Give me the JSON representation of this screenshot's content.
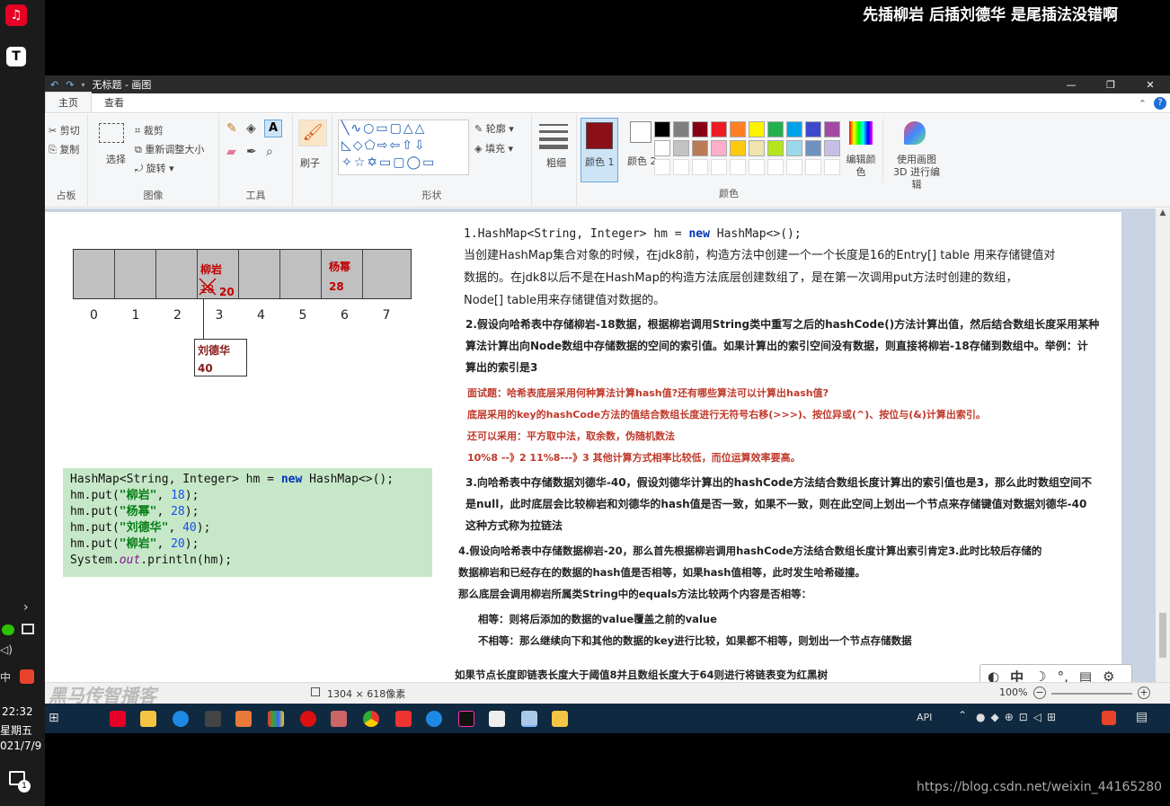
{
  "overlay_caption": "先插柳岩 后插刘德华 是尾插法没错啊",
  "left_taskbar": {
    "time": "22:32",
    "weekday": "星期五",
    "date": "021/7/9",
    "notify_badge": "1",
    "app_letter": "T"
  },
  "window": {
    "title": "无标题 - 画图",
    "tabs": [
      "主页",
      "查看"
    ]
  },
  "ribbon": {
    "clipboard": {
      "cut": "剪切",
      "copy": "复制",
      "label": "占板"
    },
    "image": {
      "select": "选择",
      "crop": "裁剪",
      "resize": "重新调整大小",
      "rotate": "旋转",
      "label": "图像"
    },
    "tools": {
      "label": "工具"
    },
    "brush": {
      "label": "刷子"
    },
    "shapes": {
      "outline": "轮廓",
      "fill": "填充",
      "label": "形状"
    },
    "size": {
      "label": "粗细"
    },
    "color1": {
      "label": "颜色 1",
      "value": "#8b0f18"
    },
    "color2": {
      "label": "颜色 2",
      "value": "#ffffff"
    },
    "edit_colors": "编辑颜色",
    "paint3d": "使用画图 3D 进行编辑",
    "colors_label": "颜色",
    "palette_row1": [
      "#000000",
      "#7f7f7f",
      "#880015",
      "#ed1c24",
      "#ff7f27",
      "#fff200",
      "#22b14c",
      "#00a2e8",
      "#3f48cc",
      "#a349a4"
    ],
    "palette_row2": [
      "#ffffff",
      "#c3c3c3",
      "#b97a57",
      "#ffaec9",
      "#ffc90e",
      "#efe4b0",
      "#b5e61d",
      "#99d9ea",
      "#7092be",
      "#c8bfe7"
    ]
  },
  "array_diagram": {
    "indices": [
      "0",
      "1",
      "2",
      "3",
      "4",
      "5",
      "6",
      "7"
    ],
    "cell3_name": "柳岩",
    "cell3_old": "18",
    "cell3_new": "20",
    "cell6_name": "杨幂",
    "cell6_value": "28",
    "node_name": "刘德华",
    "node_value": "40"
  },
  "code": {
    "line1_a": "HashMap<String, Integer> hm = ",
    "line1_kw": "new",
    "line1_b": " HashMap<>();",
    "puts": [
      {
        "key": "\"柳岩\"",
        "val": "18"
      },
      {
        "key": "\"杨幂\"",
        "val": "28"
      },
      {
        "key": "\"刘德华\"",
        "val": "40"
      },
      {
        "key": "\"柳岩\"",
        "val": "20"
      }
    ],
    "put_prefix": "hm.put(",
    "sep": ", ",
    "suffix": ");",
    "print_a": "System.",
    "print_out": "out",
    "print_b": ".println(hm);"
  },
  "notes": {
    "p1_code_a": "1.HashMap<String, Integer> hm = ",
    "p1_code_kw": "new",
    "p1_code_b": " HashMap<>();",
    "p1_l1": "当创建HashMap集合对象的时候，在jdk8前，构造方法中创建一个一个长度是16的Entry[] table 用来存储键值对",
    "p1_l2": "数据的。在jdk8以后不是在HashMap的构造方法底层创建数组了，是在第一次调用put方法时创建的数组，",
    "p1_l3": "Node[] table用来存储键值对数据的。",
    "p2_l1": "2.假设向哈希表中存储柳岩-18数据，根据柳岩调用String类中重写之后的hashCode()方法计算出值，然后结合数组长度采用某种",
    "p2_l2": "算法计算出向Node数组中存储数据的空间的索引值。如果计算出的索引空间没有数据，则直接将柳岩-18存储到数组中。举例：计",
    "p2_l3": "算出的索引是3",
    "q1": "面试题：哈希表底层采用何种算法计算hash值?还有哪些算法可以计算出hash值?",
    "q2": "底层采用的key的hashCode方法的值结合数组长度进行无符号右移(>>>)、按位异或(^)、按位与(&)计算出索引。",
    "q3": "还可以采用：平方取中法，取余数，伪随机数法",
    "q4": "10%8 --》2  11%8---》3 其他计算方式相率比较低，而位运算效率要高。",
    "p3_l1": "3.向哈希表中存储数据刘德华-40，假设刘德华计算出的hashCode方法结合数组长度计算出的索引值也是3，那么此时数组空间不",
    "p3_l2": "是null，此时底层会比较柳岩和刘德华的hash值是否一致，如果不一致，则在此空间上划出一个节点来存储键值对数据刘德华-40",
    "p3_l3": "这种方式称为拉链法",
    "p4_l1": "4.假设向哈希表中存储数据柳岩-20，那么首先根据柳岩调用hashCode方法结合数组长度计算出索引肯定3.此时比较后存储的",
    "p4_l2": "数据柳岩和已经存在的数据的hash值是否相等，如果hash值相等，此时发生哈希碰撞。",
    "p4_l3": "那么底层会调用柳岩所属类String中的equals方法比较两个内容是否相等：",
    "p4_eq": "相等：则将后添加的数据的value覆盖之前的value",
    "p4_neq": "不相等：那么继续向下和其他的数据的key进行比较，如果都不相等，则划出一个节点存储数据",
    "p5": "如果节点长度即链表长度大于阈值8并且数组长度大于64则进行将链表变为红黑树"
  },
  "status": {
    "dims": "1304 × 618像素",
    "zoom": "100%",
    "watermark": "黑马传智播客"
  },
  "systray": {
    "api": "API"
  },
  "ime": {
    "mode": "中"
  },
  "footer_url": "https://blog.csdn.net/weixin_44165280"
}
